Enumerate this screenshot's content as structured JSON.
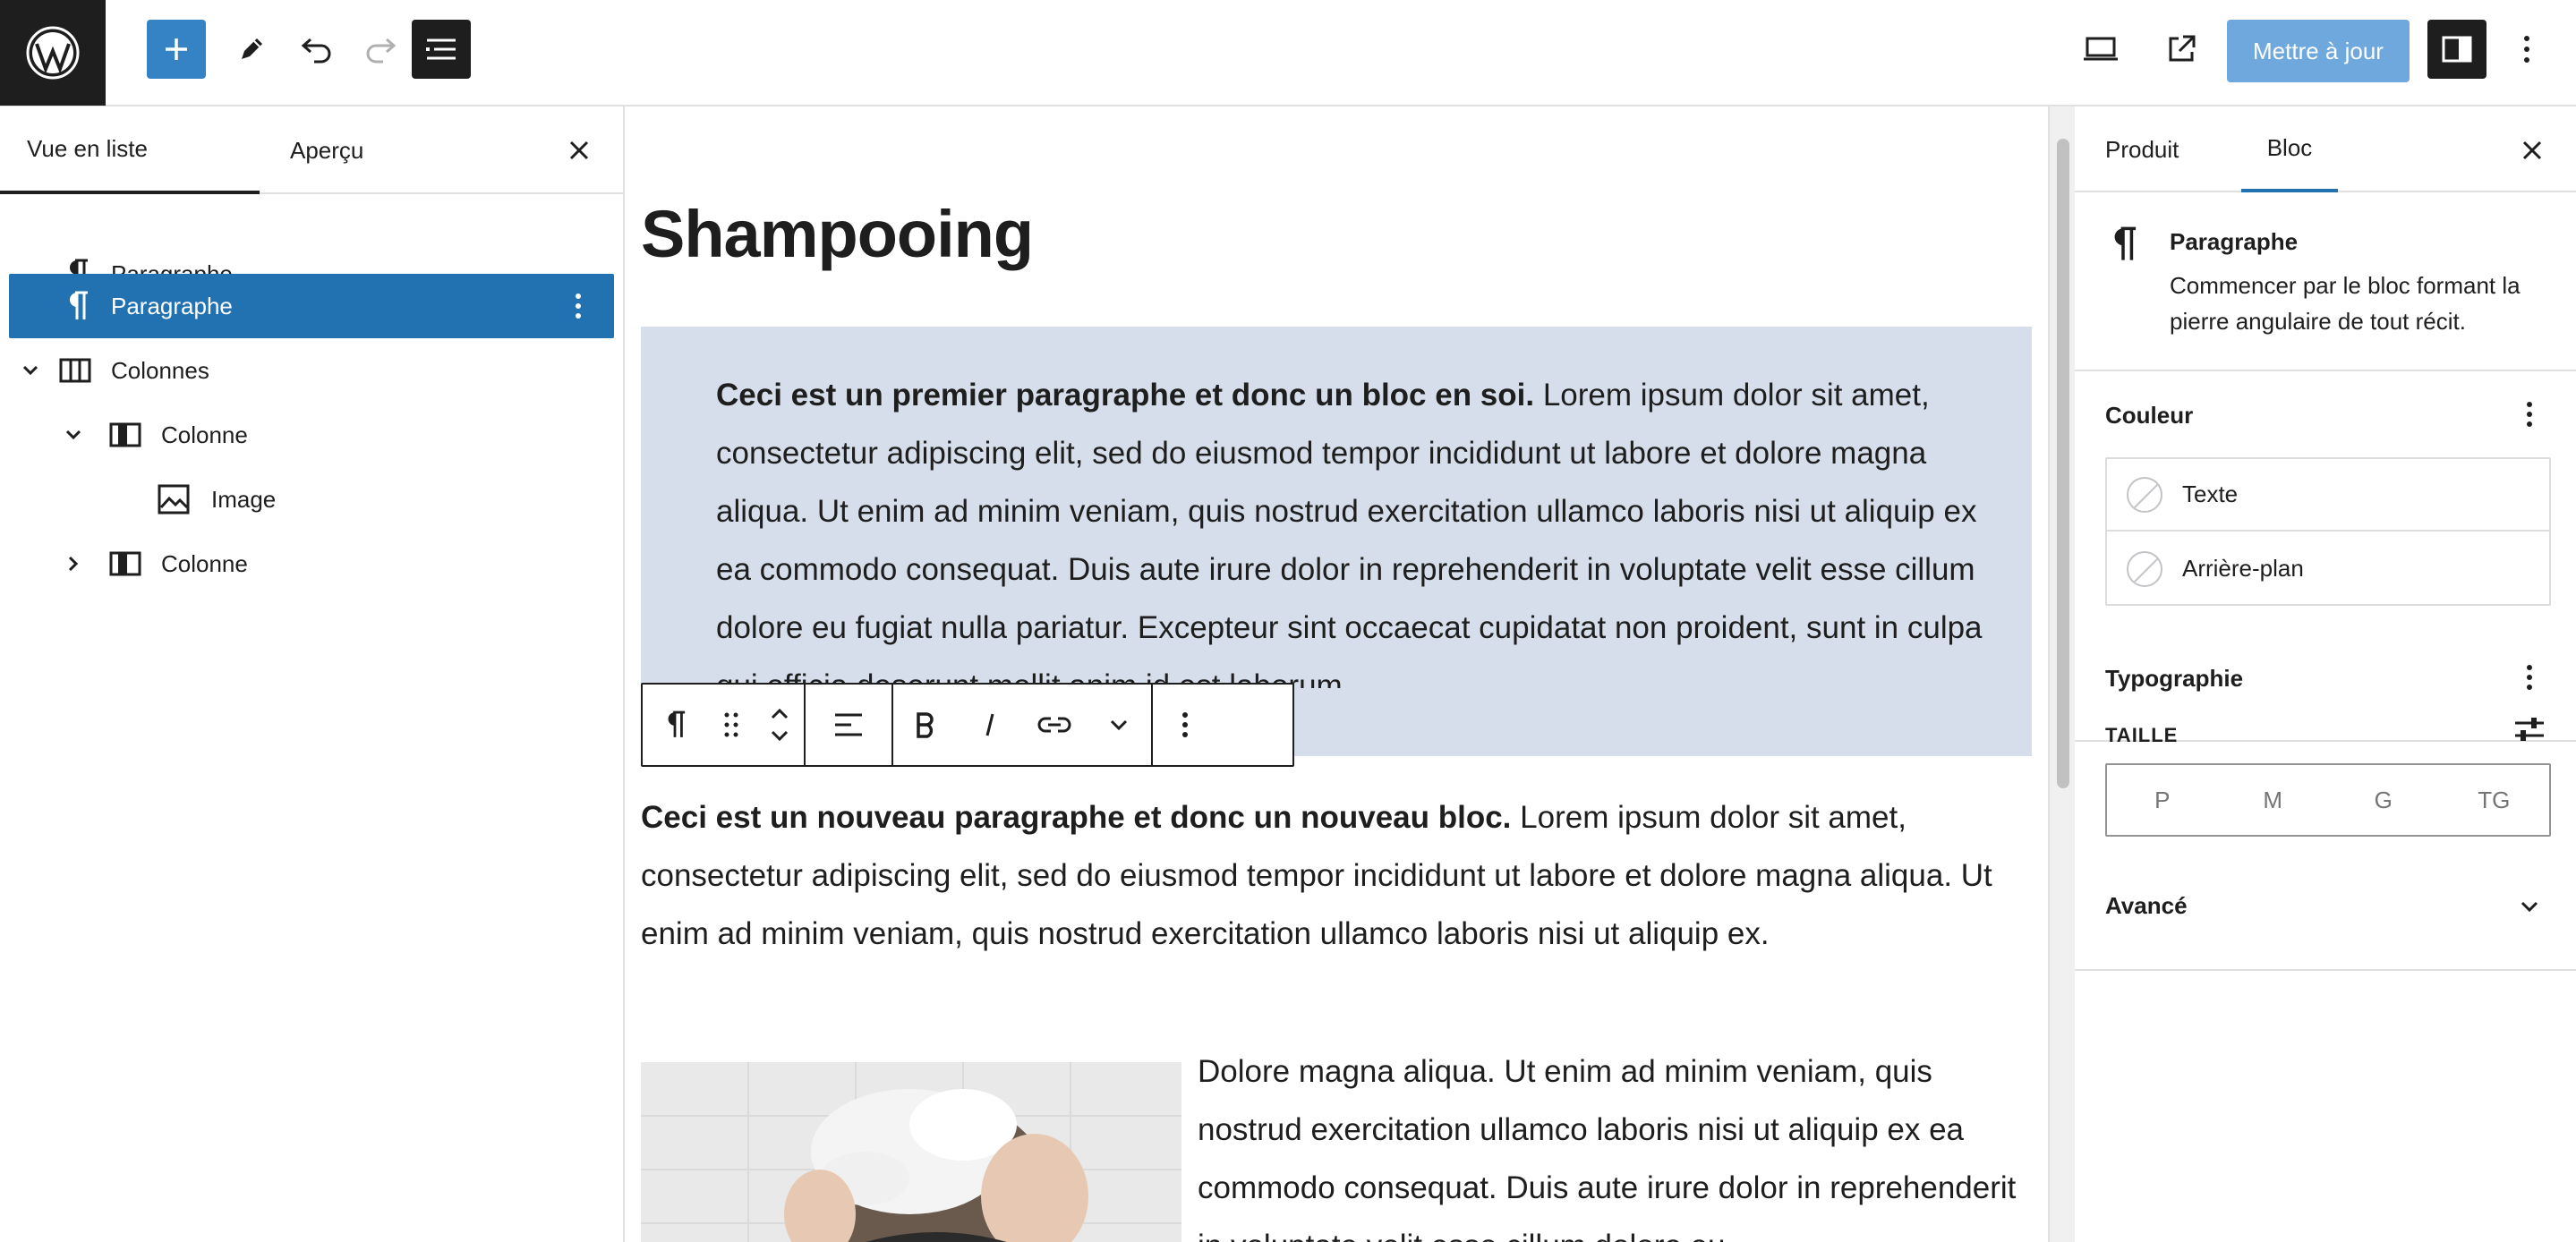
{
  "toolbar": {
    "add_block": "plus-icon",
    "tools": "pencil-icon",
    "undo": "undo-icon",
    "redo": "redo-icon",
    "list_view": "list-view-icon",
    "preview": "desktop-icon",
    "view_post": "external-link-icon",
    "update_label": "Mettre à jour",
    "settings": "sidebar-icon",
    "options": "more-vertical-icon"
  },
  "list_view": {
    "tabs": [
      "Vue en liste",
      "Aperçu"
    ],
    "items": [
      {
        "label": "Paragraphe",
        "icon": "paragraph-icon",
        "level": 0,
        "selected": false
      },
      {
        "label": "Paragraphe",
        "icon": "paragraph-icon",
        "level": 0,
        "selected": true
      },
      {
        "label": "Colonnes",
        "icon": "columns-icon",
        "level": 0,
        "expanded": true
      },
      {
        "label": "Colonne",
        "icon": "column-icon",
        "level": 1,
        "expanded": true
      },
      {
        "label": "Image",
        "icon": "image-icon",
        "level": 2
      },
      {
        "label": "Colonne",
        "icon": "column-icon",
        "level": 1,
        "expanded": false
      }
    ]
  },
  "editor": {
    "title": "Shampooing",
    "para1_bold": "Ceci est un premier paragraphe et donc un bloc en soi.",
    "para1_text": "Lorem ipsum dolor sit amet, consectetur adipiscing elit, sed do eiusmod tempor incididunt ut labore et dolore magna aliqua. Ut enim ad minim veniam, quis nostrud exercitation ullamco laboris nisi ut aliquip ex ea commodo consequat. Duis aute irure dolor in reprehenderit in voluptate velit esse cillum dolore eu fugiat nulla pariatur. Excepteur sint occaecat cupidatat non proident, sunt in culpa qui officia deserunt mollit anim id est laborum.",
    "para2_bold": "Ceci est un nouveau paragraphe et donc un nouveau bloc.",
    "para2_text": "Lorem ipsum dolor sit amet, consectetur adipiscing elit, sed do eiusmod tempor incididunt ut labore et dolore magna aliqua. Ut enim ad minim veniam, quis nostrud exercitation ullamco laboris nisi ut aliquip ex.",
    "para3_text": "Dolore magna aliqua. Ut enim ad minim veniam, quis nostrud exercitation ullamco laboris nisi ut aliquip ex ea commodo consequat. Duis aute irure dolor in reprehenderit in voluptate velit esse cillum dolore eu"
  },
  "block_toolbar": {
    "buttons": [
      "paragraph-icon",
      "drag-handle-icon",
      "move-up-icon",
      "move-down-icon",
      "align-icon",
      "bold-icon",
      "italic-icon",
      "link-icon",
      "chevron-down-icon",
      "more-vertical-icon"
    ]
  },
  "settings": {
    "tabs": [
      "Produit",
      "Bloc"
    ],
    "block_name": "Paragraphe",
    "block_description": "Commencer par le bloc formant la pierre angulaire de tout récit.",
    "color": {
      "title": "Couleur",
      "items": [
        "Texte",
        "Arrière-plan"
      ]
    },
    "typography": {
      "title": "Typographie",
      "size_label": "TAILLE",
      "sizes": [
        "P",
        "M",
        "G",
        "TG"
      ]
    },
    "advanced": "Avancé"
  },
  "colors": {
    "accent": "#3582c4",
    "selected_row": "#2271b1",
    "block_highlight": "#d5deea",
    "update_button": "#6ea8dd"
  }
}
